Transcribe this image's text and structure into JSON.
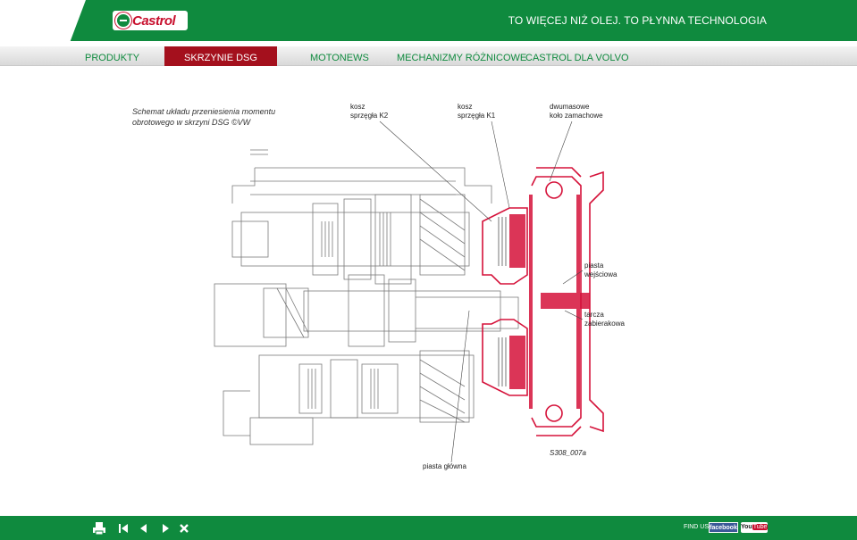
{
  "header": {
    "brand": "Castrol",
    "tagline": "TO WIĘCEJ NIŻ OLEJ. TO PŁYNNA TECHNOLOGIA"
  },
  "nav": {
    "items": [
      "PRODUKTY",
      "SKRZYNIE DSG",
      "MOTONEWS",
      "MECHANIZMY RÓŻNICOWE",
      "CASTROL DLA VOLVO"
    ],
    "active": "SKRZYNIE DSG"
  },
  "content": {
    "caption": "Schemat układu przeniesienia momentu obrotowego w skrzyni DSG ©VW",
    "figure": {
      "labels": {
        "k2": "kosz\nsprzęgła K2",
        "k1": "kosz\nsprzęgła K1",
        "flywheel": "dwumasowe\nkoło zamachowe",
        "input_hub": "piasta\nwejściowa",
        "driver_disc": "tarcza\nzabierakowa",
        "main_hub": "piasta główna",
        "code": "S308_007a"
      }
    }
  },
  "footer": {
    "find_us": "FIND US:",
    "facebook": "facebook",
    "youtube_you": "You",
    "youtube_tube": "Tube"
  },
  "colors": {
    "brand_green": "#0f8a3e",
    "active_red": "#a4101d",
    "diagram_red": "#d5123a"
  }
}
